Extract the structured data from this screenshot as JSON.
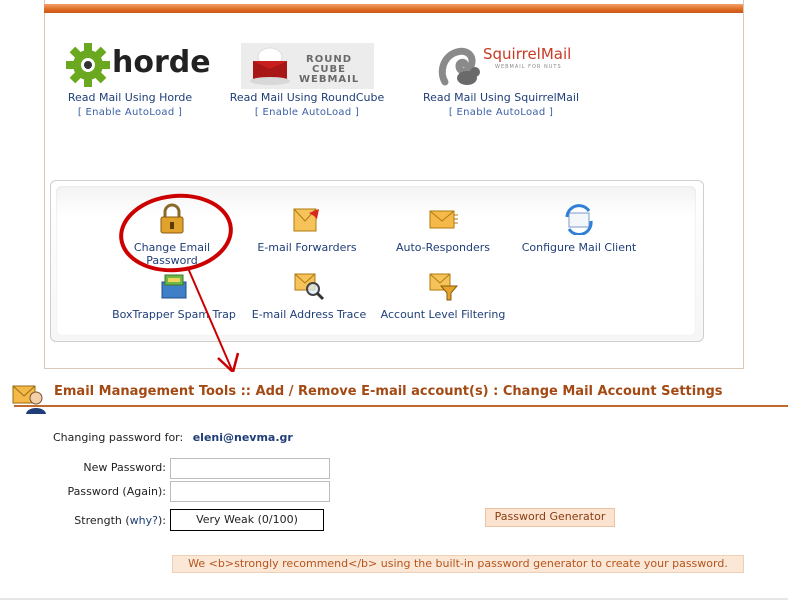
{
  "webmail": [
    {
      "label": "Read Mail Using Horde",
      "autoload": "[ Enable AutoLoad ]",
      "logo_text": "horde"
    },
    {
      "label": "Read Mail Using RoundCube",
      "autoload": "[ Enable AutoLoad ]",
      "logo_text": "ROUND CUBE WEBMAIL"
    },
    {
      "label": "Read Mail Using SquirrelMail",
      "autoload": "[ Enable AutoLoad ]",
      "logo_text": "SquirrelMail",
      "logo_sub": "WEBMAIL FOR NUTS"
    }
  ],
  "tools": [
    {
      "label": "Change Email Password",
      "icon": "padlock-icon"
    },
    {
      "label": "E-mail Forwarders",
      "icon": "forward-envelope-icon"
    },
    {
      "label": "Auto-Responders",
      "icon": "envelope-icon"
    },
    {
      "label": "Configure Mail Client",
      "icon": "sync-envelope-icon"
    },
    {
      "label": "BoxTrapper Spam Trap",
      "icon": "mailbox-icon"
    },
    {
      "label": "E-mail Address Trace",
      "icon": "magnifier-envelope-icon"
    },
    {
      "label": "Account Level Filtering",
      "icon": "filter-envelope-icon"
    }
  ],
  "tool_lines": {
    "change_email_1": "Change Email",
    "change_email_2": "Password"
  },
  "breadcrumb": {
    "item1": "Email Management Tools",
    "sep1": "::",
    "item2": "Add / Remove E-mail account(s)",
    "sep2": ":",
    "item3": "Change Mail Account Settings"
  },
  "form": {
    "changing_label": "Changing password for:",
    "account": "eleni@nevma.gr",
    "new_password_label": "New Password:",
    "new_password_value": "",
    "again_label": "Password (Again):",
    "again_value": "",
    "strength_label": "Strength (",
    "why_link": "why?",
    "strength_close": "):",
    "strength_value": "Very Weak (0/100)",
    "generator_button": "Password Generator",
    "recommend_text": "We <b>strongly recommend</b> using the built-in password generator to create your password."
  },
  "colors": {
    "accent": "#dd6a20",
    "title": "#a34a14",
    "link": "#1f3e78",
    "highlight_circle": "#cc0000"
  }
}
